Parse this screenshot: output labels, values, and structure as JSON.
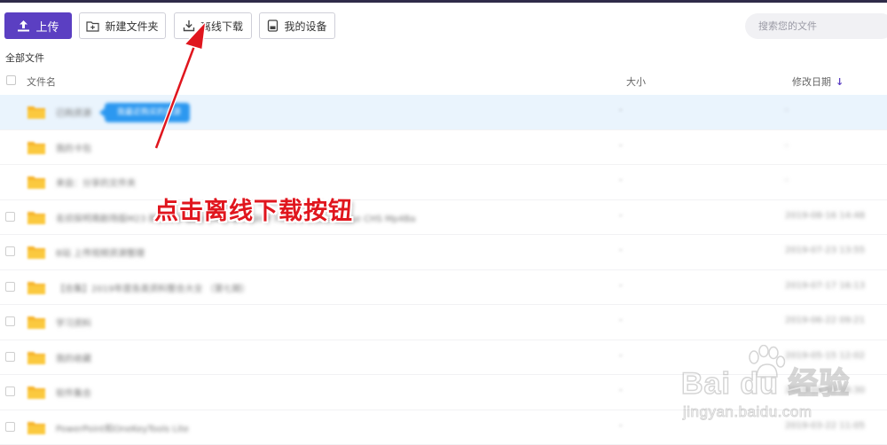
{
  "toolbar": {
    "upload_label": "上传",
    "new_folder_label": "新建文件夹",
    "offline_download_label": "离线下载",
    "my_devices_label": "我的设备"
  },
  "search": {
    "placeholder": "搜索您的文件"
  },
  "breadcrumb": "全部文件",
  "columns": {
    "name": "文件名",
    "size": "大小",
    "modified": "修改日期"
  },
  "files": [
    {
      "name": "已购资源",
      "size": "-",
      "date": "-",
      "selected": true,
      "tooltip": "我最近购买的资源"
    },
    {
      "name": "我的卡包",
      "size": "-",
      "date": "-"
    },
    {
      "name": "来自：分享的文件夹",
      "size": "-",
      "date": "-"
    },
    {
      "name": "名侦探柯南剧场版M23 紺青の拳 2019 HDRip 1080P X264 AAC Japanese CHS Mp4Ba",
      "size": "-",
      "date": "2019-08-16 14:48"
    },
    {
      "name": "B站 上传视频资源整理",
      "size": "-",
      "date": "2019-07-23 13:55"
    },
    {
      "name": "【合集】2019年度各类资料整合大全 （第七期）",
      "size": "-",
      "date": "2019-07-17 16:13"
    },
    {
      "name": "学习资料",
      "size": "-",
      "date": "2019-06-22 09:21"
    },
    {
      "name": "我的收藏",
      "size": "-",
      "date": "2019-05-15 12:02"
    },
    {
      "name": "软件集合",
      "size": "-",
      "date": "2019-04-03 18:30"
    },
    {
      "name": "PowerPoint和OneKeyTools Lite",
      "size": "-",
      "date": "2019-03-22 11:05"
    }
  ],
  "annotation": "点击离线下载按钮",
  "watermark": {
    "logo": "Bai du 经验",
    "url": "jingyan.baidu.com"
  },
  "colors": {
    "accent": "#5b3fc2",
    "annotation": "#e0161e",
    "folder": "#f9c53e",
    "tooltip": "#2c98f0"
  },
  "icons": {
    "upload": "upload-icon",
    "new_folder": "folder-plus-icon",
    "offline_download": "download-icon",
    "my_devices": "device-icon",
    "sort": "arrow-down-icon",
    "folder": "folder-icon"
  }
}
